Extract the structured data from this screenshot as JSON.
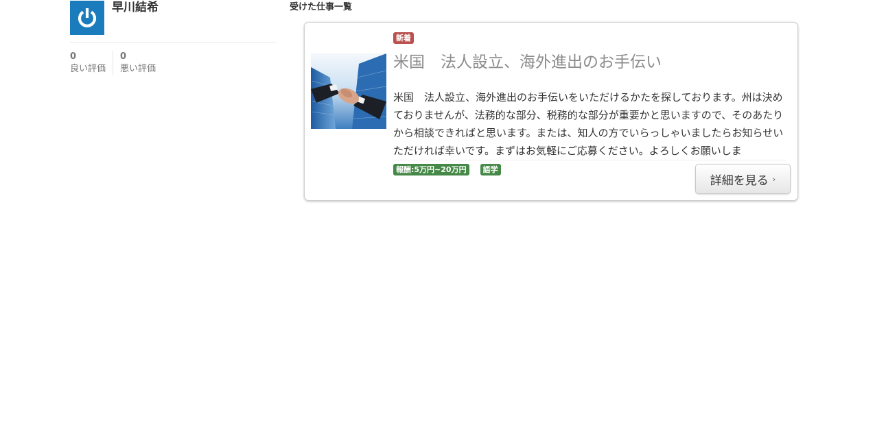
{
  "profile": {
    "name": "早川結希",
    "ratings": {
      "good": {
        "count": "0",
        "label": "良い評価"
      },
      "bad": {
        "count": "0",
        "label": "悪い評価"
      }
    }
  },
  "section": {
    "title": "受けた仕事一覧"
  },
  "job": {
    "badge": "新着",
    "title": "米国　法人設立、海外進出のお手伝い",
    "description": "米国　法人設立、海外進出のお手伝いをいただけるかたを探しております。州は決めておりませんが、法務的な部分、税務的な部分が重要かと思いますので、そのあたりから相談できればと思います。または、知人の方でいらっしゃいましたらお知らせいただければ幸いです。まずはお気軽にご応募ください。よろしくお願いしま",
    "tags": [
      "報酬:5万円~20万円",
      "語学"
    ],
    "detail_button": "詳細を見る"
  },
  "colors": {
    "avatar_bg": "#1a7bbd",
    "badge_new": "#b9524e",
    "tag": "#468847",
    "title_text": "#8c8c8c"
  },
  "icons": {
    "avatar": "power-icon",
    "button_arrow": "chevron-right-icon"
  }
}
